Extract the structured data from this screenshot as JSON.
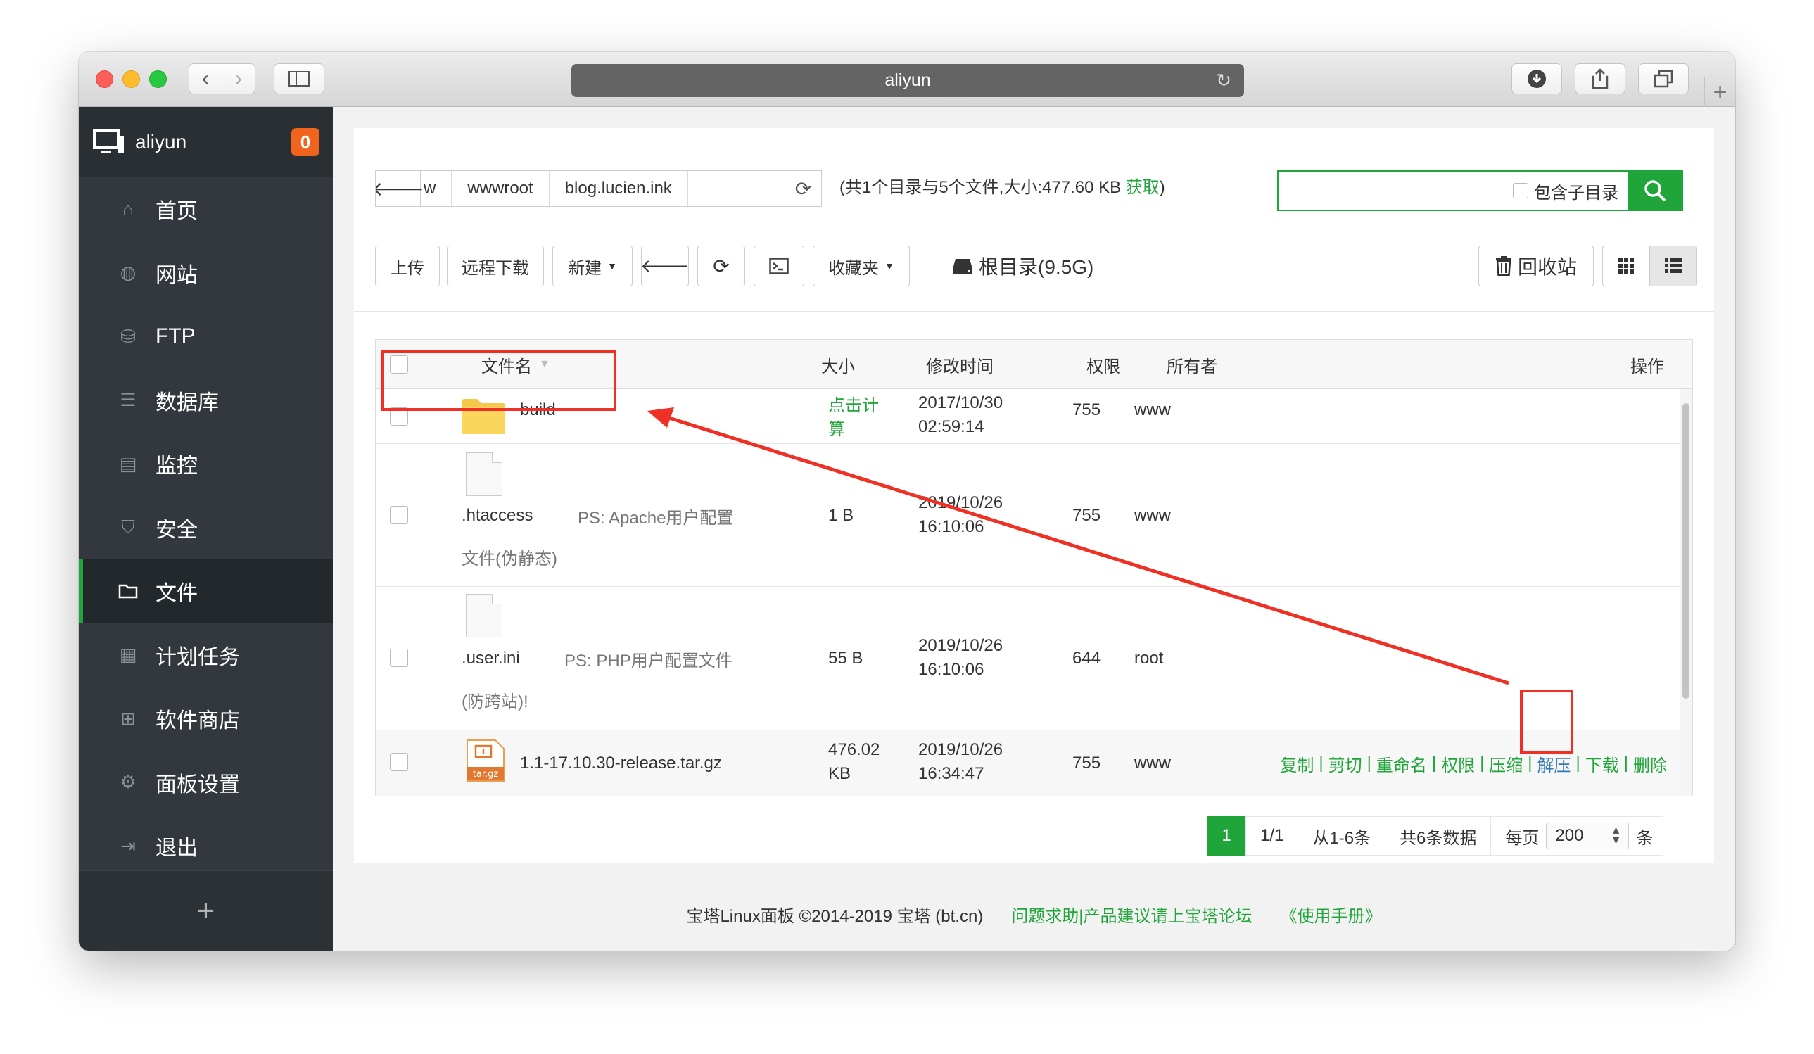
{
  "browser": {
    "address": "aliyun",
    "nav_back_icon": "chevron-left",
    "nav_forward_icon": "chevron-right"
  },
  "sidebar": {
    "server_name": "aliyun",
    "badge_count": "0",
    "items": [
      {
        "label": "首页",
        "icon": "home-icon"
      },
      {
        "label": "网站",
        "icon": "globe-icon"
      },
      {
        "label": "FTP",
        "icon": "ftp-icon"
      },
      {
        "label": "数据库",
        "icon": "database-icon"
      },
      {
        "label": "监控",
        "icon": "monitor-icon"
      },
      {
        "label": "安全",
        "icon": "shield-icon"
      },
      {
        "label": "文件",
        "icon": "folder-icon",
        "active": true
      },
      {
        "label": "计划任务",
        "icon": "calendar-icon"
      },
      {
        "label": "软件商店",
        "icon": "apps-icon"
      },
      {
        "label": "面板设置",
        "icon": "gear-icon"
      },
      {
        "label": "退出",
        "icon": "logout-icon"
      }
    ],
    "add_label": "+"
  },
  "path": {
    "crumbs": [
      "w",
      "wwwroot",
      "blog.lucien.ink"
    ],
    "info_prefix": "(共1个目录与5个文件,大小:477.60 KB",
    "info_link": "获取",
    "info_suffix": ")"
  },
  "search": {
    "placeholder": "",
    "subdir_label": "包含子目录"
  },
  "toolbar": {
    "upload": "上传",
    "remote_download": "远程下载",
    "new": "新建",
    "favorites": "收藏夹",
    "root_dir": "根目录(9.5G)",
    "recycle_bin": "回收站"
  },
  "table": {
    "headers": {
      "name": "文件名",
      "size": "大小",
      "mtime": "修改时间",
      "perm": "权限",
      "owner": "所有者",
      "ops": "操作"
    },
    "rows": [
      {
        "name": "build",
        "note": "",
        "size_line1": "点击计",
        "size_line2": "算",
        "time1": "2017/10/30",
        "time2": "02:59:14",
        "perm": "755",
        "owner": "www",
        "type": "folder"
      },
      {
        "name": ".htaccess",
        "note": "PS: Apache用户配置",
        "note2": "文件(伪静态)",
        "size_line1": "1 B",
        "time1": "2019/10/26",
        "time2": "16:10:06",
        "perm": "755",
        "owner": "www",
        "type": "file"
      },
      {
        "name": ".user.ini",
        "note": "PS: PHP用户配置文件",
        "note2": "(防跨站)!",
        "size_line1": "55 B",
        "time1": "2019/10/26",
        "time2": "16:10:06",
        "perm": "644",
        "owner": "root",
        "type": "file"
      },
      {
        "name": "1.1-17.10.30-release.tar.gz",
        "note": "",
        "size_line1": "476.02",
        "size_line2": "KB",
        "time1": "2019/10/26",
        "time2": "16:34:47",
        "perm": "755",
        "owner": "www",
        "type": "archive",
        "archive_label": "tar.gz"
      }
    ],
    "row_ops": [
      "复制",
      "剪切",
      "重命名",
      "权限",
      "压缩",
      "解压",
      "下载",
      "删除"
    ]
  },
  "pager": {
    "current": "1",
    "pages": "1/1",
    "range": "从1-6条",
    "total": "共6条数据",
    "per_page_label": "每页",
    "per_page_value": "200",
    "per_page_unit": "条"
  },
  "footer": {
    "copyright": "宝塔Linux面板 ©2014-2019 宝塔 (bt.cn)",
    "forum": "问题求助|产品建议请上宝塔论坛",
    "manual": "《使用手册》"
  },
  "colors": {
    "accent": "#20a53a",
    "sidebar_bg": "#32383e",
    "annotation": "#ee3124",
    "badge": "#f0641e"
  }
}
